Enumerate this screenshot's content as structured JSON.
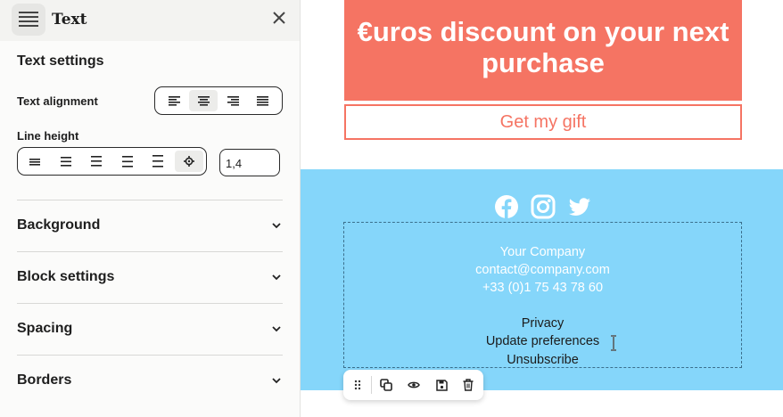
{
  "panel": {
    "title": "Text",
    "icon": "text-block-icon",
    "section_title": "Text settings",
    "text_alignment_label": "Text alignment",
    "alignment_options": [
      "align-left-icon",
      "align-center-icon",
      "align-right-icon",
      "align-justify-icon"
    ],
    "alignment_selected": "align-center-icon",
    "line_height_label": "Line height",
    "line_height_options": [
      "line-height-1-icon",
      "line-height-2-icon",
      "line-height-3-icon",
      "line-height-4-icon",
      "line-height-5-icon",
      "line-height-custom-icon"
    ],
    "line_height_selected": "line-height-custom-icon",
    "line_height_value": "1,4",
    "accordions": [
      "Background",
      "Block settings",
      "Spacing",
      "Borders"
    ]
  },
  "email": {
    "promo_text": "€uros discount on your next purchase",
    "gift_button": "Get my gift",
    "social_icons": [
      "facebook-icon",
      "instagram-icon",
      "twitter-icon"
    ],
    "company_lines": [
      "Your Company",
      "contact@company.com",
      "+33 (0)1 75 43 78 60"
    ],
    "footer_links": [
      "Privacy",
      "Update preferences",
      "Unsubscribe"
    ]
  },
  "block_toolbar": [
    "drag-handle-icon",
    "duplicate-icon",
    "preview-icon",
    "save-icon",
    "delete-icon"
  ],
  "colors": {
    "promo_background": "#f57463",
    "footer_background": "#85d6fa",
    "panel_background": "#fbfbfa"
  }
}
